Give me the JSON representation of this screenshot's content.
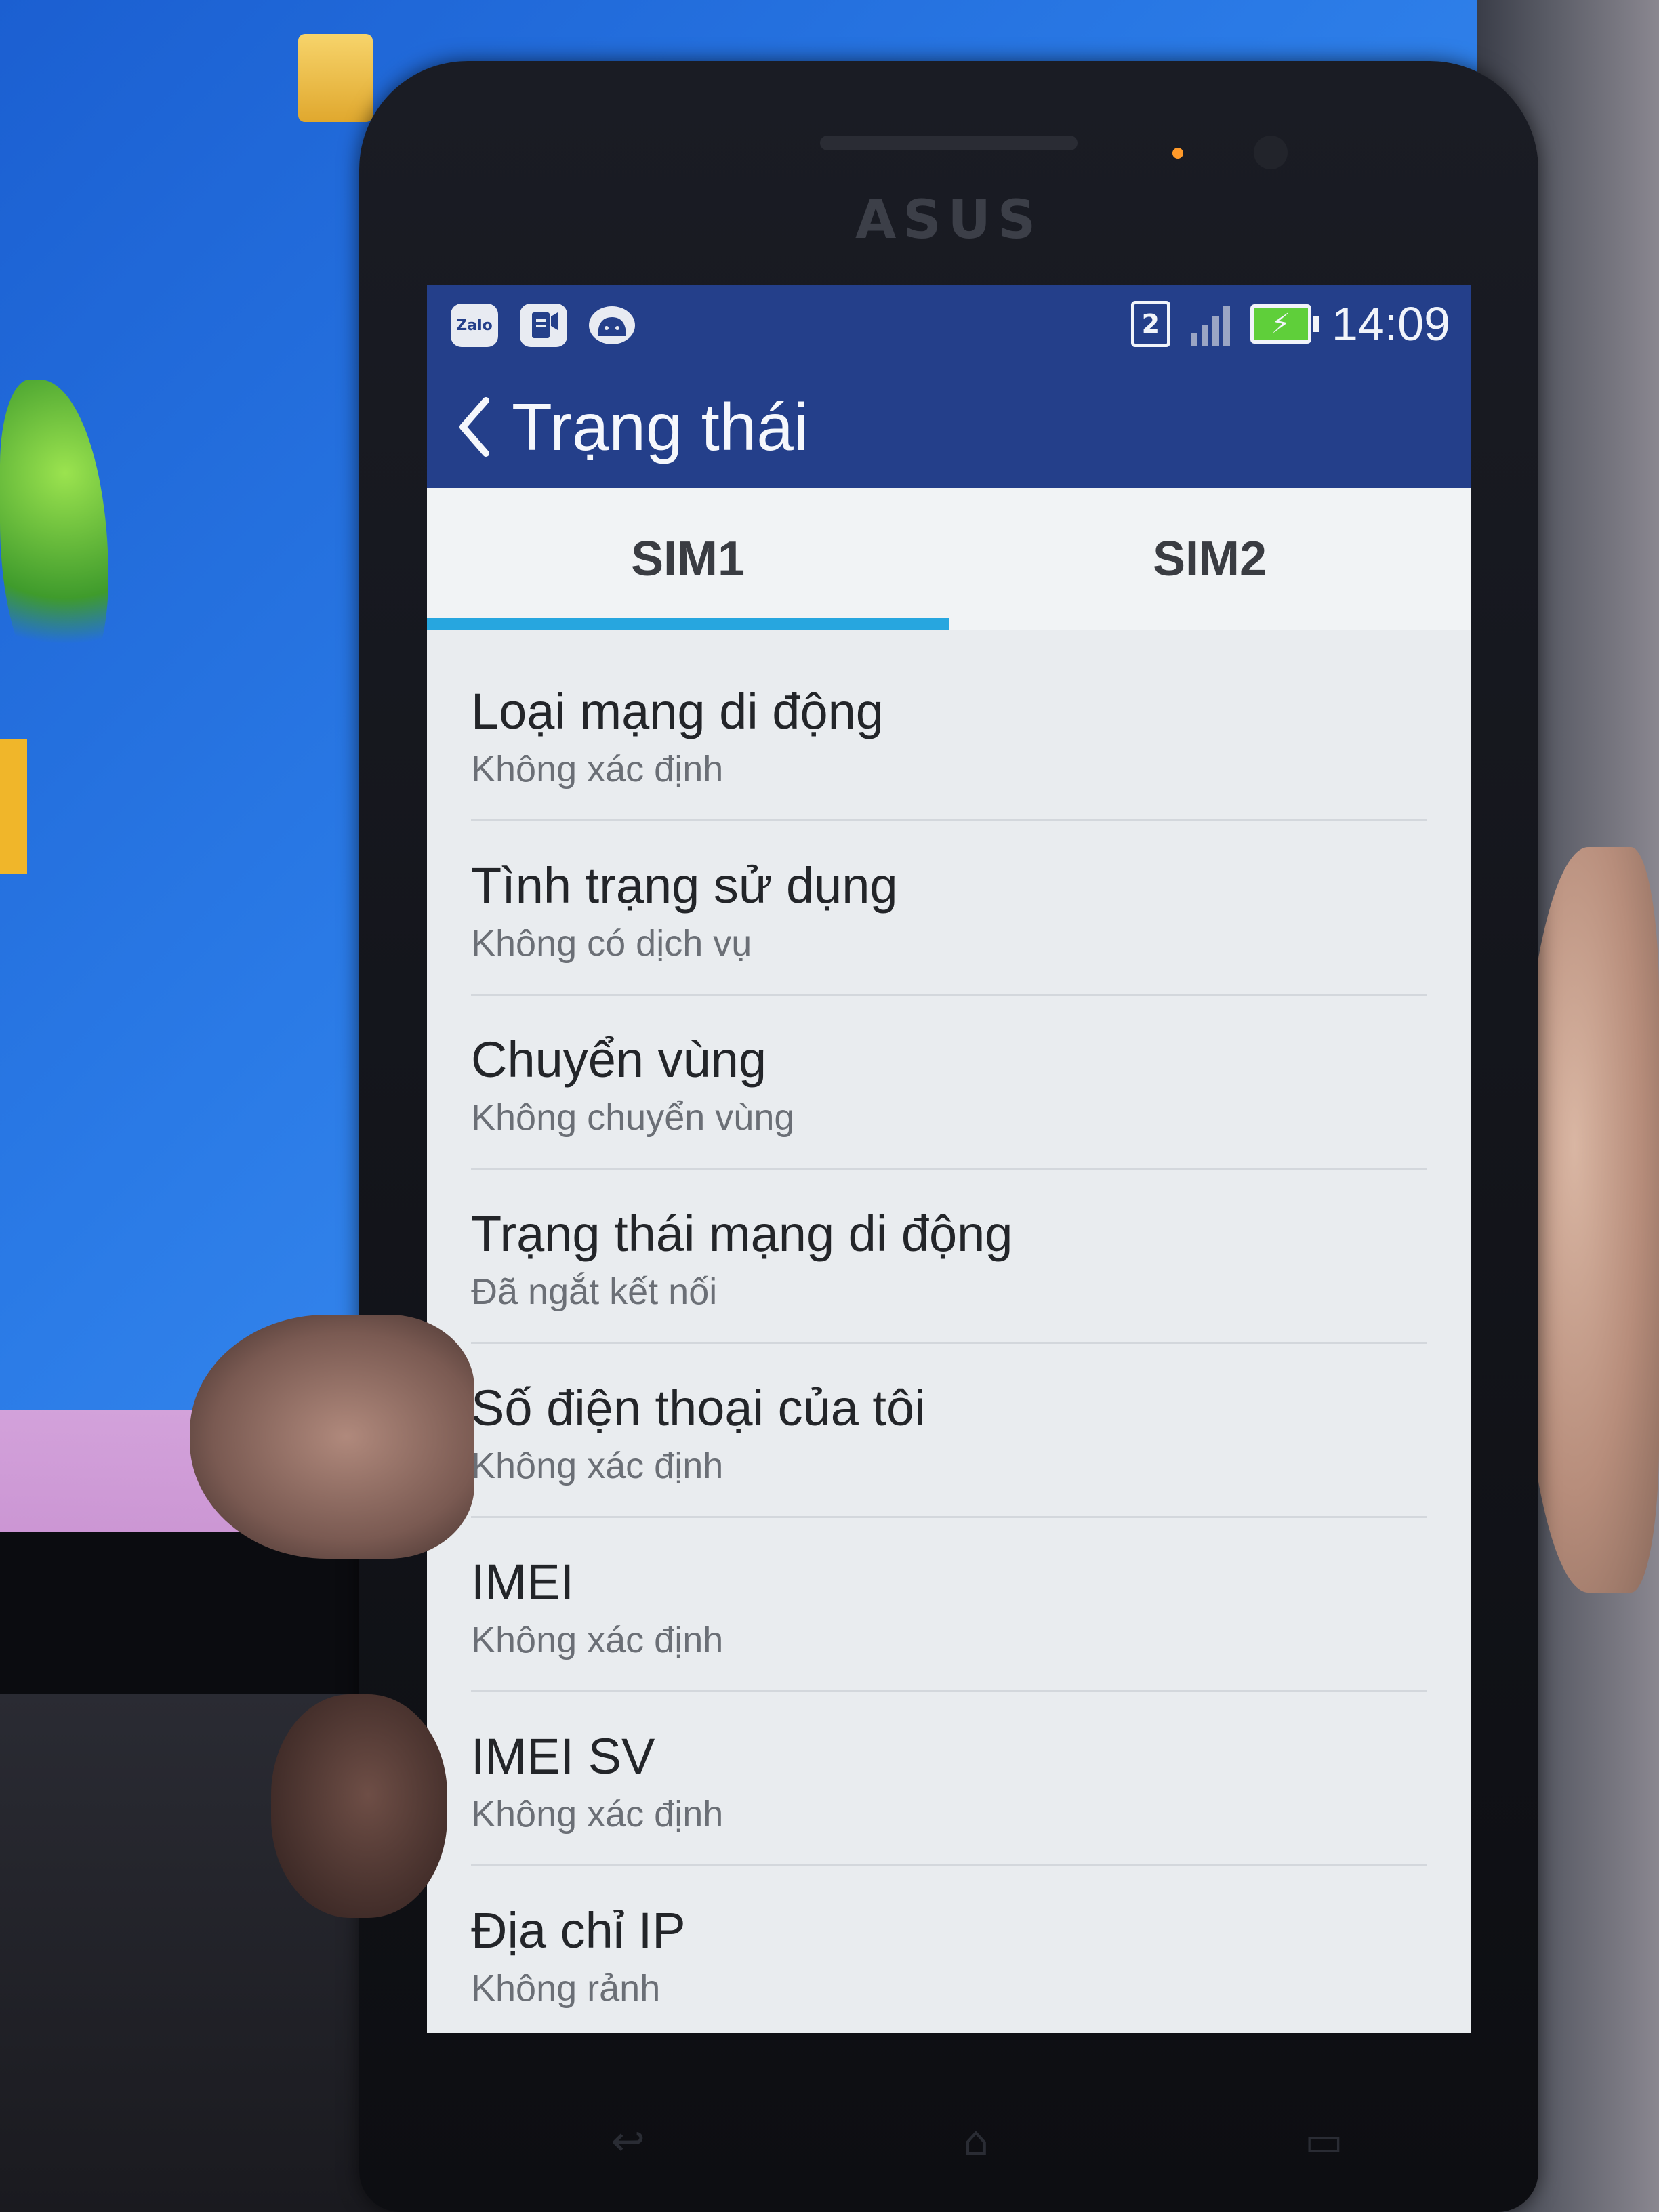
{
  "status_bar": {
    "notification_icons": [
      "zalo-icon",
      "sim-toolkit-icon",
      "android-debug-icon"
    ],
    "zalo_label": "Zalo",
    "sim_indicator": "2",
    "time": "14:09",
    "colors": {
      "background": "#243f8a",
      "battery": "#5fcf3a"
    }
  },
  "header": {
    "back_icon": "chevron-left-icon",
    "title": "Trạng thái"
  },
  "tabs": [
    {
      "label": "SIM1",
      "active": true
    },
    {
      "label": "SIM2",
      "active": false
    }
  ],
  "accent_color": "#27a6df",
  "status_items": [
    {
      "title": "Loại mạng di động",
      "summary": "Không xác định"
    },
    {
      "title": "Tình trạng sử dụng",
      "summary": "Không có dịch vụ"
    },
    {
      "title": "Chuyển vùng",
      "summary": "Không chuyển vùng"
    },
    {
      "title": "Trạng thái mạng di động",
      "summary": "Đã ngắt kết nối"
    },
    {
      "title": "Số điện thoại của tôi",
      "summary": "Không xác định"
    },
    {
      "title": "IMEI",
      "summary": "Không xác định"
    },
    {
      "title": "IMEI SV",
      "summary": "Không xác định"
    },
    {
      "title": "Địa chỉ IP",
      "summary": "Không rảnh"
    }
  ],
  "device": {
    "brand_logo": "ASUS"
  }
}
